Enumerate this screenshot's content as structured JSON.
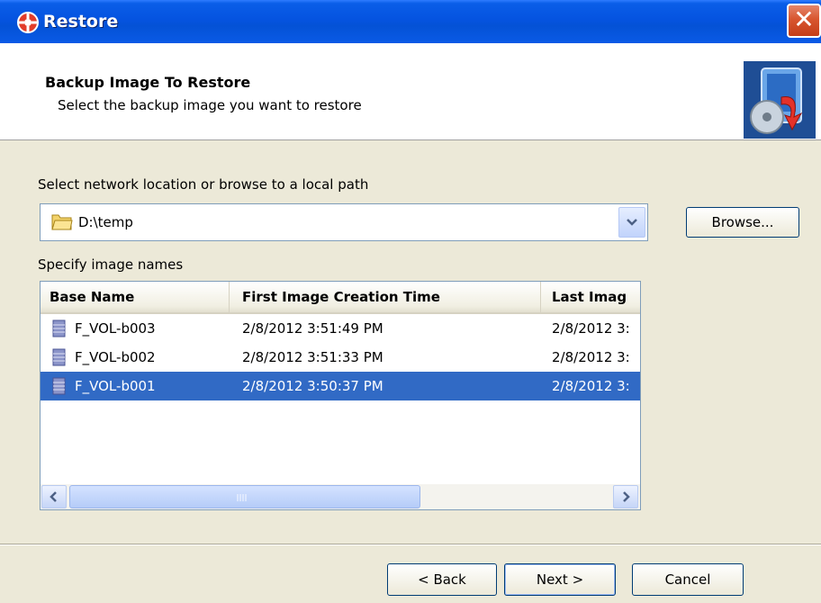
{
  "window": {
    "title": "Restore",
    "close_glyph": "✕",
    "app_icon": "restore-app-icon"
  },
  "header": {
    "title": "Backup Image To Restore",
    "subtitle": "Select the backup image you want to restore",
    "icon": "restore-disk-icon"
  },
  "location": {
    "label": "Select network location or browse to a local path",
    "value": "D:\\temp",
    "browse_label": "Browse..."
  },
  "images": {
    "label": "Specify image names",
    "columns": [
      "Base Name",
      "First Image Creation Time",
      "Last Imag"
    ],
    "rows": [
      {
        "name": "F_VOL-b003",
        "first": "2/8/2012 3:51:49 PM",
        "last": "2/8/2012 3:"
      },
      {
        "name": "F_VOL-b002",
        "first": "2/8/2012 3:51:33 PM",
        "last": "2/8/2012 3:"
      },
      {
        "name": "F_VOL-b001",
        "first": "2/8/2012 3:50:37 PM",
        "last": "2/8/2012 3:"
      }
    ],
    "selected_row": 2
  },
  "footer": {
    "back_label": "< Back",
    "next_label": "Next >",
    "cancel_label": "Cancel"
  },
  "colors": {
    "titlebar": "#0553e0",
    "selection": "#316ac5",
    "close": "#d8552f"
  }
}
